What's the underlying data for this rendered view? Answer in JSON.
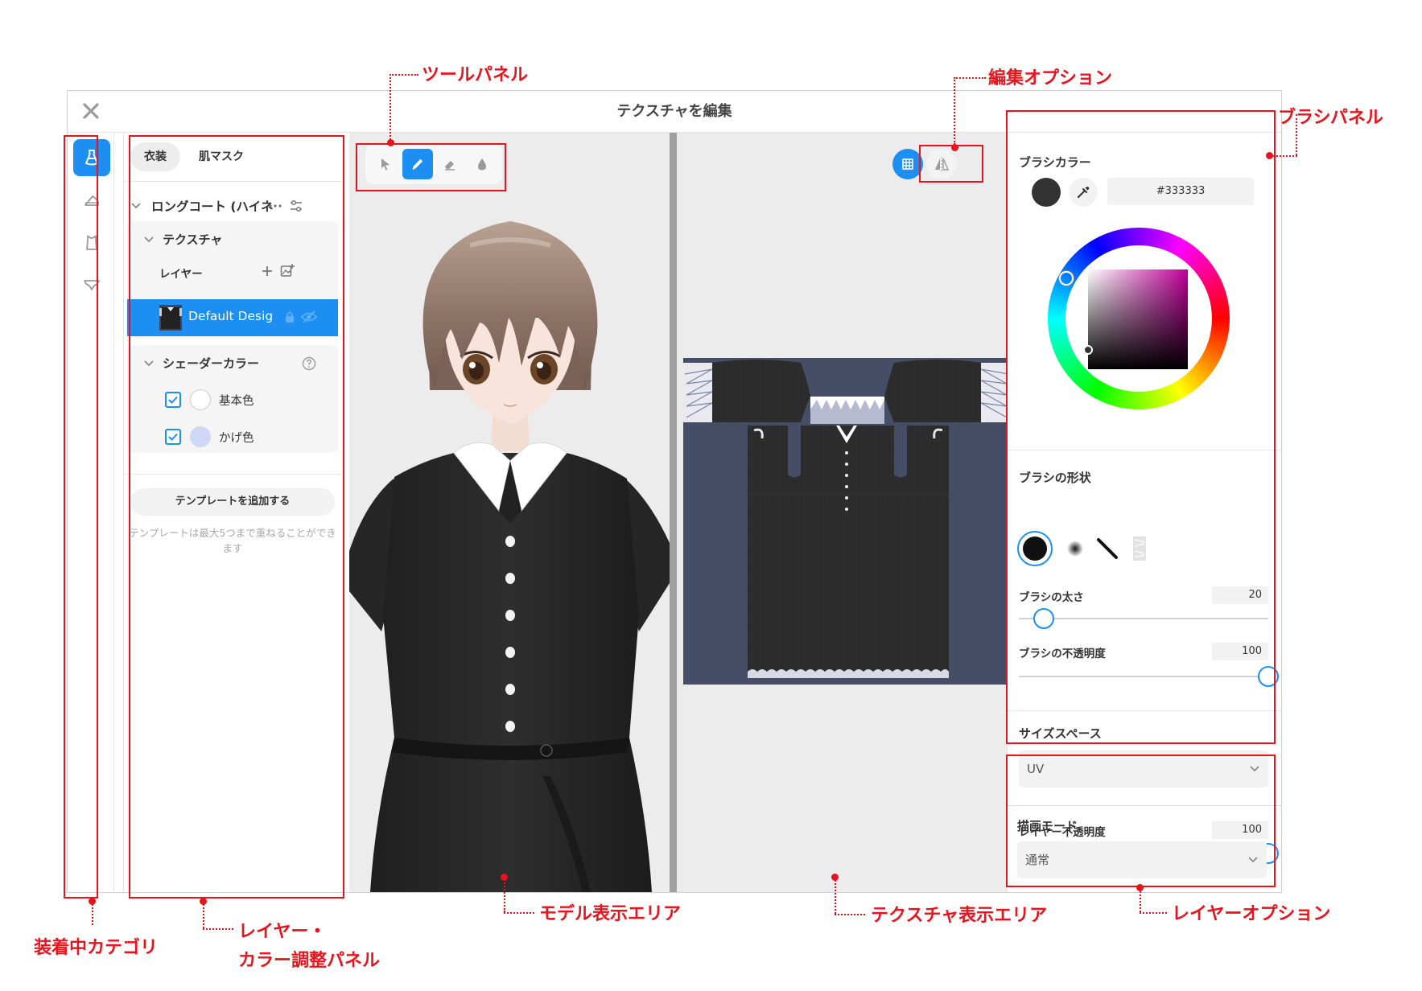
{
  "window": {
    "title": "テクスチャを編集"
  },
  "category_sidebar": {
    "items": [
      {
        "icon": "dress-icon",
        "active": true
      },
      {
        "icon": "shoe-icon",
        "active": false
      },
      {
        "icon": "top-icon",
        "active": false
      },
      {
        "icon": "underwear-icon",
        "active": false
      }
    ]
  },
  "layer_panel": {
    "tabs": [
      "衣装",
      "肌マスク"
    ],
    "active_tab": "衣装",
    "item_name": "ロングコート (ハイネ",
    "texture_label": "テクスチャ",
    "layers_label": "レイヤー",
    "layer_row": {
      "name": "Default Desig"
    },
    "shader_label": "シェーダーカラー",
    "shader_colors": [
      {
        "label": "基本色",
        "checked": true,
        "color": "#ffffff"
      },
      {
        "label": "かげ色",
        "checked": true,
        "color": "#cfd8f4"
      }
    ],
    "add_template": "テンプレートを追加する",
    "template_note": "テンプレートは最大5つまで重ねることができます"
  },
  "tools": {
    "items": [
      "select-tool",
      "pen-tool",
      "eraser-tool",
      "dropper-tool"
    ],
    "active": "pen-tool"
  },
  "edit_options": {
    "items": [
      "uv-grid-toggle",
      "mirror-toggle"
    ],
    "active": "uv-grid-toggle"
  },
  "brush_panel": {
    "color_title": "ブラシカラー",
    "color_hex": "#333333",
    "shape_title": "ブラシの形状",
    "size_label": "ブラシの太さ",
    "size_value": "20",
    "size_fraction": 0.1,
    "opacity_label": "ブラシの不透明度",
    "opacity_value": "100",
    "opacity_fraction": 1.0,
    "space_title": "サイズスペース",
    "space_value": "UV"
  },
  "layer_options": {
    "opacity_label": "レイヤー不透明度",
    "opacity_value": "100",
    "opacity_fraction": 1.0,
    "mode_title": "描画モード",
    "mode_value": "通常"
  },
  "annotations": {
    "tool_panel": "ツールパネル",
    "edit_options": "編集オプション",
    "brush_panel": "ブラシパネル",
    "category": "装着中カテゴリ",
    "layer_color_1": "レイヤー・",
    "layer_color_2": "カラー調整パネル",
    "model_area": "モデル表示エリア",
    "texture_area": "テクスチャ表示エリア",
    "layer_options": "レイヤーオプション"
  },
  "colors": {
    "accent": "#1d8ff2",
    "annotation": "#e8131c",
    "texture_background": "#454d67",
    "garment": "#2a2a2a"
  }
}
